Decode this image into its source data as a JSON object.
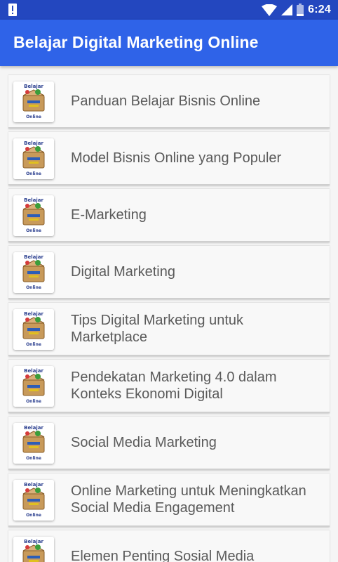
{
  "status_bar": {
    "time": "6:24",
    "icons": [
      "alert-icon",
      "wifi-icon",
      "signal-icon",
      "battery-icon"
    ]
  },
  "app_bar": {
    "title": "Belajar Digital Marketing Online"
  },
  "thumbnail": {
    "logo_text_top": "Belajar",
    "logo_text_bottom": "Online"
  },
  "items": [
    {
      "title": "Panduan Belajar Bisnis Online"
    },
    {
      "title": "Model Bisnis Online yang Populer"
    },
    {
      "title": "E-Marketing"
    },
    {
      "title": "Digital Marketing"
    },
    {
      "title": "Tips Digital Marketing untuk Marketplace"
    },
    {
      "title": "Pendekatan Marketing 4.0 dalam Konteks Ekonomi Digital"
    },
    {
      "title": "Social Media Marketing"
    },
    {
      "title": "Online Marketing untuk Meningkatkan Social Media Engagement"
    },
    {
      "title": "Elemen Penting Sosial Media"
    }
  ],
  "colors": {
    "status_bar": "#2347bf",
    "app_bar": "#2f63e8",
    "background": "#f5f5f5",
    "item_text": "#5a5a5a"
  }
}
